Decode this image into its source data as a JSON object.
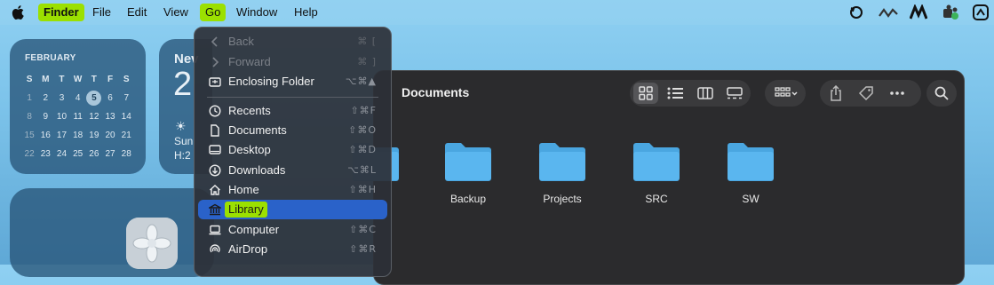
{
  "menubar": {
    "items": [
      {
        "label": "Finder"
      },
      {
        "label": "File"
      },
      {
        "label": "Edit"
      },
      {
        "label": "View"
      },
      {
        "label": "Go"
      },
      {
        "label": "Window"
      },
      {
        "label": "Help"
      }
    ],
    "highlight_color": "#9be000",
    "status_icons": [
      "sync-icon",
      "activity-icon",
      "m-logo-icon",
      "teams-icon",
      "control-center-icon"
    ]
  },
  "calendar_widget": {
    "month": "FEBRUARY",
    "weekdays": [
      "S",
      "M",
      "T",
      "W",
      "T",
      "F",
      "S"
    ],
    "weeks": [
      [
        "1",
        "2",
        "3",
        "4",
        "5",
        "6",
        "7"
      ],
      [
        "8",
        "9",
        "10",
        "11",
        "12",
        "13",
        "14"
      ],
      [
        "15",
        "16",
        "17",
        "18",
        "19",
        "20",
        "21"
      ],
      [
        "22",
        "23",
        "24",
        "25",
        "26",
        "27",
        "28"
      ]
    ],
    "today": "5"
  },
  "news_widget": {
    "title": "Nev",
    "big": "2",
    "line1": "Sun",
    "line2": "H:2"
  },
  "finder": {
    "title": "Documents",
    "folders": [
      {
        "label": ""
      },
      {
        "label": "Backup"
      },
      {
        "label": "Projects"
      },
      {
        "label": "SRC"
      },
      {
        "label": "SW"
      }
    ],
    "folder_color": "#5ab6ef"
  },
  "go_menu": {
    "items": [
      {
        "label": "Back",
        "shortcut": "⌘ [",
        "disabled": true,
        "icon": "chevron-left-icon"
      },
      {
        "label": "Forward",
        "shortcut": "⌘ ]",
        "disabled": true,
        "icon": "chevron-right-icon"
      },
      {
        "label": "Enclosing Folder",
        "shortcut": "⌥⌘▲",
        "icon": "enclosing-folder-icon"
      },
      {
        "label": "Recents",
        "shortcut": "⇧⌘F",
        "icon": "clock-icon"
      },
      {
        "label": "Documents",
        "shortcut": "⇧⌘O",
        "icon": "document-icon"
      },
      {
        "label": "Desktop",
        "shortcut": "⇧⌘D",
        "icon": "desktop-icon"
      },
      {
        "label": "Downloads",
        "shortcut": "⌥⌘L",
        "icon": "download-icon"
      },
      {
        "label": "Home",
        "shortcut": "⇧⌘H",
        "icon": "home-icon"
      },
      {
        "label": "Library",
        "shortcut": "",
        "icon": "library-icon",
        "selected": true
      },
      {
        "label": "Computer",
        "shortcut": "⇧⌘C",
        "icon": "computer-icon"
      },
      {
        "label": "AirDrop",
        "shortcut": "⇧⌘R",
        "icon": "airdrop-icon"
      }
    ],
    "selected_color": "#2a62c9"
  }
}
